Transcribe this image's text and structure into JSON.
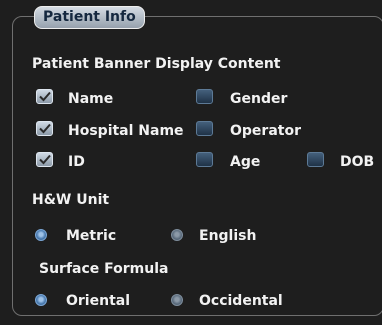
{
  "group_title": "Patient Info",
  "banner_section": {
    "heading": "Patient Banner Display Content",
    "items": [
      {
        "label": "Name",
        "checked": true
      },
      {
        "label": "Gender",
        "checked": false
      },
      {
        "label": "Hospital Name",
        "checked": true
      },
      {
        "label": "Operator",
        "checked": false
      },
      {
        "label": "ID",
        "checked": true
      },
      {
        "label": "Age",
        "checked": false
      },
      {
        "label": "DOB",
        "checked": false
      }
    ]
  },
  "hw_unit": {
    "heading": "H&W Unit",
    "options": [
      {
        "label": "Metric",
        "selected": true
      },
      {
        "label": "English",
        "selected": false
      }
    ]
  },
  "surface_formula": {
    "heading": "Surface Formula",
    "options": [
      {
        "label": "Oriental",
        "selected": true
      },
      {
        "label": "Occidental",
        "selected": false
      }
    ]
  },
  "colors": {
    "background": "#1e1e1e",
    "checkbox_checked": "#b8c4d0",
    "checkbox_unchecked": "#2e4762",
    "radio_selected": "#4e7fb4",
    "radio_unselected": "#5a6b7c"
  }
}
